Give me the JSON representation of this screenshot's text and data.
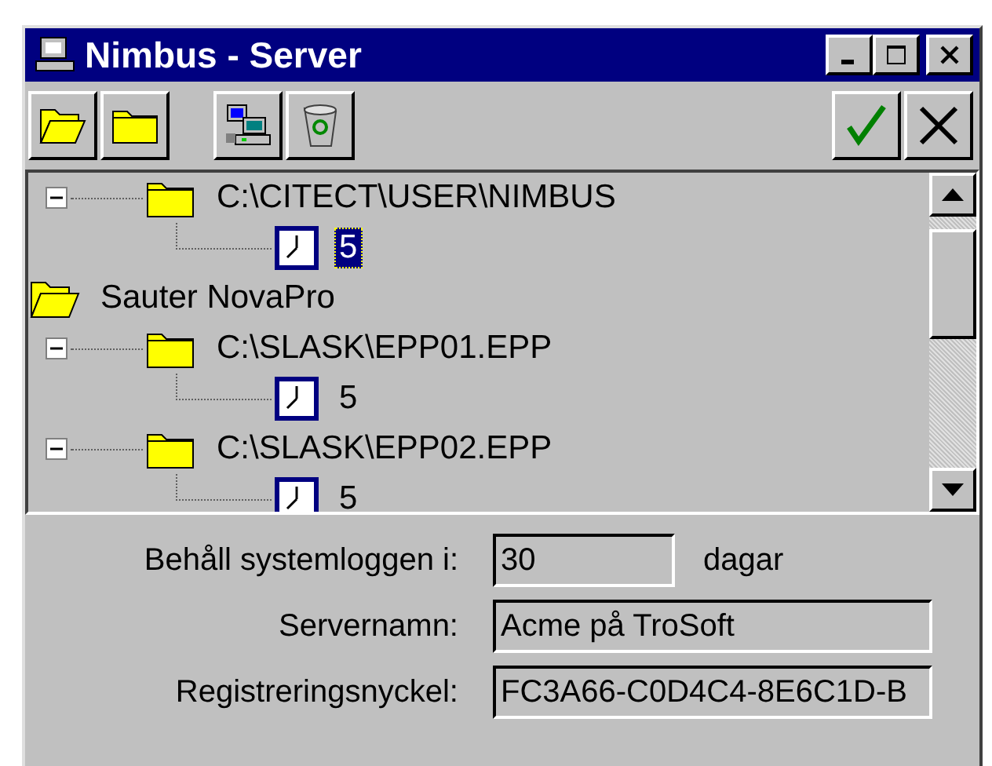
{
  "window": {
    "title": "Nimbus - Server"
  },
  "tree": {
    "nodes": [
      {
        "children": [
          {
            "label": "C:\\CITECT\\USER\\NIMBUS",
            "expanded": true,
            "children": [
              {
                "label": "5",
                "selected": true
              }
            ]
          }
        ]
      },
      {
        "label": "Sauter NovaPro",
        "expanded": true,
        "children": [
          {
            "label": "C:\\SLASK\\EPP01.EPP",
            "expanded": true,
            "children": [
              {
                "label": "5",
                "selected": false
              }
            ]
          },
          {
            "label": "C:\\SLASK\\EPP02.EPP",
            "expanded": true,
            "children": [
              {
                "label": "5",
                "selected": false
              }
            ]
          }
        ]
      }
    ]
  },
  "settings": [
    {
      "label": "Behåll systemloggen i:",
      "value": "30",
      "unit": "dagar"
    },
    {
      "label": "Servernamn:",
      "value": "Acme på TroSoft"
    },
    {
      "label": "Registreringsnyckel:",
      "value": "FC3A66-C0D4C4-8E6C1D-B"
    }
  ]
}
